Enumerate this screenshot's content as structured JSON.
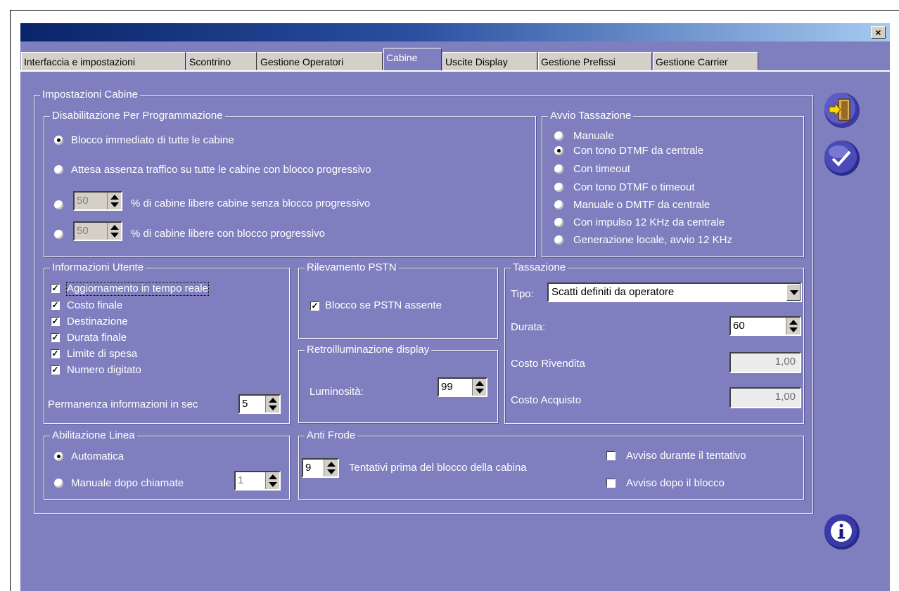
{
  "window": {
    "close_label": "×"
  },
  "tabs": [
    "Interfaccia  e impostazioni",
    "Scontrino",
    "Gestione Operatori",
    "Cabine",
    "Uscite Display",
    "Gestione Prefissi",
    "Gestione Carrier"
  ],
  "impostazioni": {
    "title": "Impostazioni Cabine"
  },
  "disabilitazione": {
    "title": "Disabilitazione Per Programmazione",
    "options": [
      "Blocco immediato di tutte le cabine",
      "Attesa assenza traffico su tutte le cabine con blocco progressivo",
      "% di cabine libere cabine senza blocco progressivo",
      "% di cabine libere con blocco progressivo"
    ],
    "selected": 0,
    "spin1": "50",
    "spin2": "50"
  },
  "avvio": {
    "title": "Avvio Tassazione",
    "options": [
      "Manuale",
      "Con tono DTMF da centrale",
      "Con timeout",
      "Con tono DTMF o timeout",
      "Manuale o DMTF da centrale",
      "Con impulso 12 KHz da centrale",
      "Generazione locale, avvio 12 KHz"
    ],
    "selected": 1
  },
  "info_utente": {
    "title": "Informazioni Utente",
    "items": [
      "Aggiornamento in tempo reale",
      "Costo finale",
      "Destinazione",
      "Durata finale",
      "Limite di spesa",
      "Numero digitato"
    ],
    "permanenza_label": "Permanenza informazioni in sec",
    "permanenza_value": "5"
  },
  "pstn": {
    "title": "Rilevamento PSTN",
    "label": "Blocco se PSTN assente"
  },
  "retro": {
    "title": "Retroilluminazione display",
    "label": "Luminosità:",
    "value": "99"
  },
  "tassazione": {
    "title": "Tassazione",
    "tipo_label": "Tipo:",
    "tipo_value": "Scatti definiti da operatore",
    "durata_label": "Durata:",
    "durata_value": "60",
    "rivendita_label": "Costo Rivendita",
    "rivendita_value": "1,00",
    "acquisto_label": "Costo Acquisto",
    "acquisto_value": "1,00"
  },
  "linea": {
    "title": "Abilitazione Linea",
    "auto_label": "Automatica",
    "manuale_label": "Manuale dopo chiamate",
    "manuale_value": "1"
  },
  "antifrode": {
    "title": "Anti Frode",
    "tentativi_value": "9",
    "tentativi_label": "Tentativi prima del blocco della cabina",
    "avviso1": "Avviso durante il tentativo",
    "avviso2": "Avviso dopo il blocco"
  },
  "colors": {
    "panel": "#7f7fbf",
    "title_dark": "#0a2468",
    "title_light": "#a6caf0"
  }
}
